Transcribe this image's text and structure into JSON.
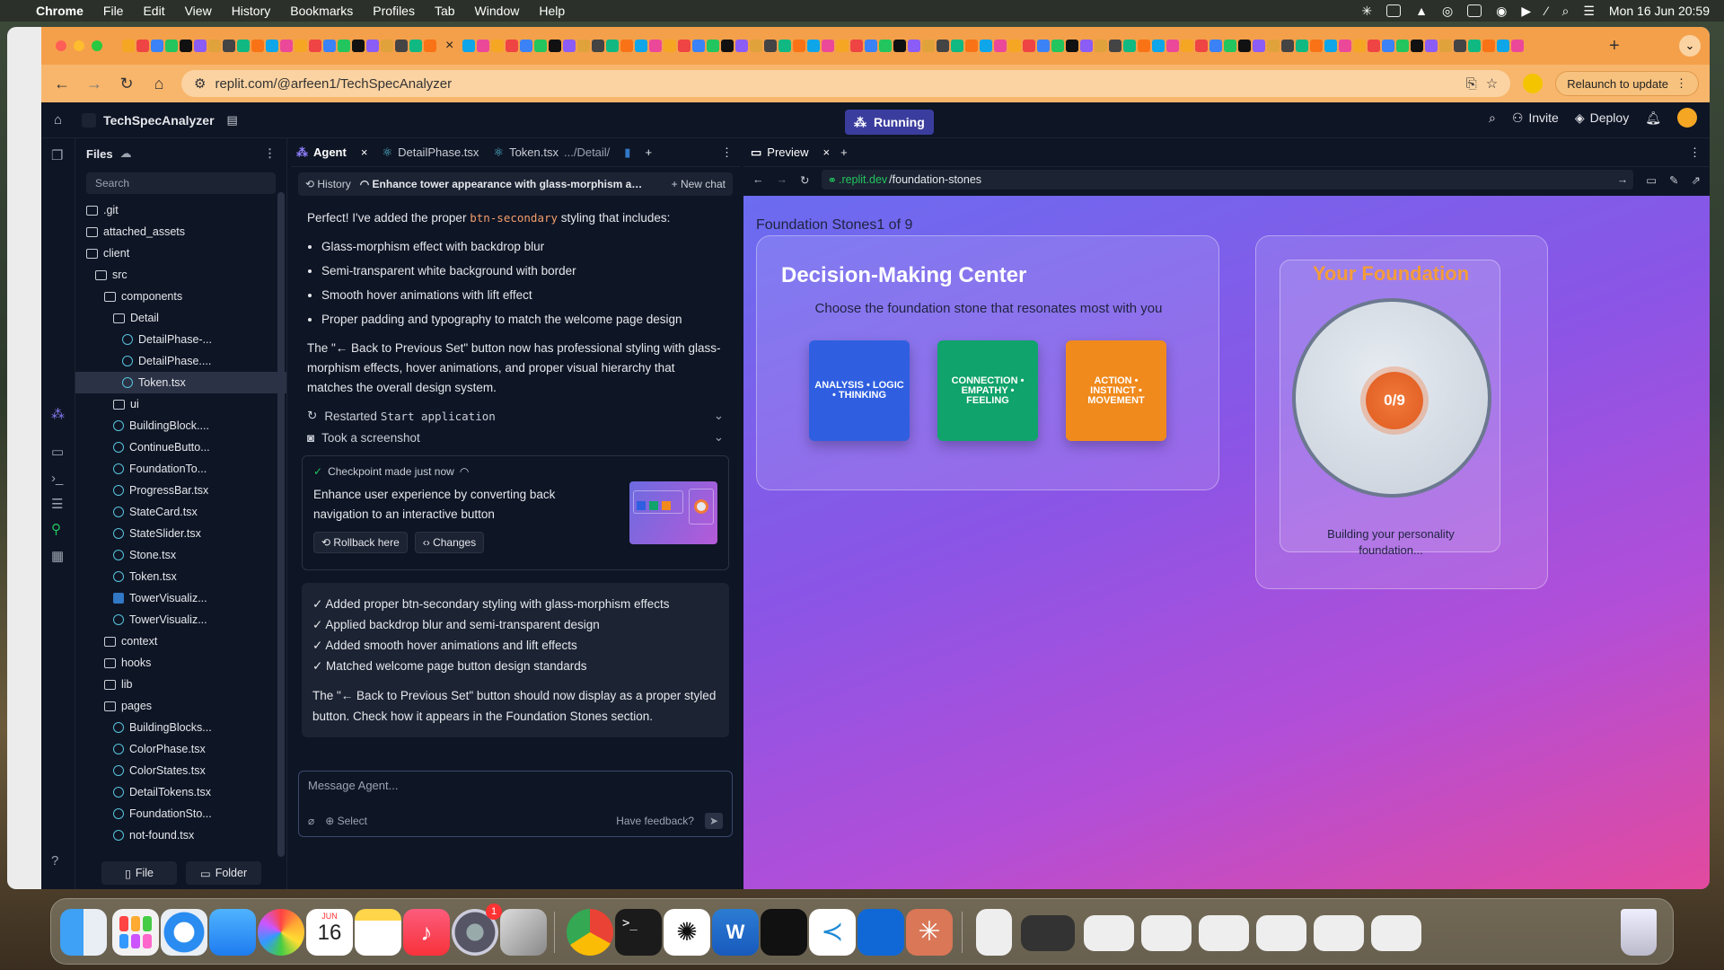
{
  "menubar": {
    "apple": "",
    "app": "Chrome",
    "items": [
      "File",
      "Edit",
      "View",
      "History",
      "Bookmarks",
      "Profiles",
      "Tab",
      "Window",
      "Help"
    ],
    "clock": "Mon 16 Jun  20:59"
  },
  "browser": {
    "url": "replit.com/@arfeen1/TechSpecAnalyzer",
    "relaunch": "Relaunch to update"
  },
  "replit": {
    "project": "TechSpecAnalyzer",
    "status": "Running",
    "invite": "Invite",
    "deploy": "Deploy"
  },
  "files": {
    "title": "Files",
    "search_placeholder": "Search",
    "new_file": "File",
    "new_folder": "Folder",
    "tree": [
      {
        "name": ".git",
        "type": "folder",
        "depth": 0
      },
      {
        "name": "attached_assets",
        "type": "folder",
        "depth": 0
      },
      {
        "name": "client",
        "type": "folder",
        "depth": 0
      },
      {
        "name": "src",
        "type": "folder",
        "depth": 1
      },
      {
        "name": "components",
        "type": "folder",
        "depth": 2
      },
      {
        "name": "Detail",
        "type": "folder",
        "depth": 3
      },
      {
        "name": "DetailPhase-...",
        "type": "react",
        "depth": 4
      },
      {
        "name": "DetailPhase....",
        "type": "react",
        "depth": 4
      },
      {
        "name": "Token.tsx",
        "type": "react",
        "depth": 4,
        "selected": true
      },
      {
        "name": "ui",
        "type": "folder",
        "depth": 3
      },
      {
        "name": "BuildingBlock....",
        "type": "react",
        "depth": 3
      },
      {
        "name": "ContinueButto...",
        "type": "react",
        "depth": 3
      },
      {
        "name": "FoundationTo...",
        "type": "react",
        "depth": 3
      },
      {
        "name": "ProgressBar.tsx",
        "type": "react",
        "depth": 3
      },
      {
        "name": "StateCard.tsx",
        "type": "react",
        "depth": 3
      },
      {
        "name": "StateSlider.tsx",
        "type": "react",
        "depth": 3
      },
      {
        "name": "Stone.tsx",
        "type": "react",
        "depth": 3
      },
      {
        "name": "Token.tsx",
        "type": "react",
        "depth": 3
      },
      {
        "name": "TowerVisualiz...",
        "type": "ts",
        "depth": 3
      },
      {
        "name": "TowerVisualiz...",
        "type": "react",
        "depth": 3
      },
      {
        "name": "context",
        "type": "folder",
        "depth": 2
      },
      {
        "name": "hooks",
        "type": "folder",
        "depth": 2
      },
      {
        "name": "lib",
        "type": "folder",
        "depth": 2
      },
      {
        "name": "pages",
        "type": "folder",
        "depth": 2
      },
      {
        "name": "BuildingBlocks...",
        "type": "react",
        "depth": 3
      },
      {
        "name": "ColorPhase.tsx",
        "type": "react",
        "depth": 3
      },
      {
        "name": "ColorStates.tsx",
        "type": "react",
        "depth": 3
      },
      {
        "name": "DetailTokens.tsx",
        "type": "react",
        "depth": 3
      },
      {
        "name": "FoundationSto...",
        "type": "react",
        "depth": 3
      },
      {
        "name": "not-found.tsx",
        "type": "react",
        "depth": 3
      }
    ]
  },
  "agent": {
    "tabs": [
      {
        "label": "Agent"
      },
      {
        "label": "DetailPhase.tsx"
      },
      {
        "label": "Token.tsx",
        "path": ".../Detail/"
      }
    ],
    "history": "History",
    "thread": "Enhance tower appearance with glass-morphism and...",
    "new_chat": "New chat",
    "intro_pre": "Perfect! I've added the proper ",
    "intro_code": "btn-secondary",
    "intro_post": " styling that includes:",
    "bullets": [
      "Glass-morphism effect with backdrop blur",
      "Semi-transparent white background with border",
      "Smooth hover animations with lift effect",
      "Proper padding and typography to match the welcome page design"
    ],
    "para": "The \"← Back to Previous Set\" button now has professional styling with glass-morphism effects, hover animations, and proper visual hierarchy that matches the overall design system.",
    "action1_pre": "Restarted ",
    "action1_code": "Start application",
    "action2": "Took a screenshot",
    "checkpoint": {
      "status": "Checkpoint made just now",
      "desc": "Enhance user experience by converting back navigation to an interactive button",
      "rollback": "Rollback here",
      "changes": "Changes"
    },
    "summary": [
      "✓ Added proper btn-secondary styling with glass-morphism effects",
      "✓ Applied backdrop blur and semi-transparent design",
      "✓ Added smooth hover animations and lift effects",
      "✓ Matched welcome page button design standards"
    ],
    "summary_para": "The \"← Back to Previous Set\" button should now display as a proper styled button. Check how it appears in the Foundation Stones section.",
    "input_placeholder": "Message Agent...",
    "select": "Select",
    "feedback": "Have feedback?"
  },
  "preview": {
    "tab": "Preview",
    "url_host": ".replit.dev",
    "url_path": "/foundation-stones",
    "counter": "Foundation Stones1 of 9",
    "card_title": "Decision-Making Center",
    "card_sub": "Choose the foundation stone that resonates most with you",
    "stones": [
      {
        "label": "ANALYSIS • LOGIC • THINKING",
        "color": "#2f5fe0"
      },
      {
        "label": "CONNECTION • EMPATHY • FEELING",
        "color": "#10a36b"
      },
      {
        "label": "ACTION • INSTINCT • MOVEMENT",
        "color": "#f08a1c"
      }
    ],
    "foundation_title": "Your Foundation",
    "progress": "0/9",
    "foundation_caption": "Building your personality foundation..."
  },
  "dock": {
    "calendar_month": "JUN",
    "calendar_day": "16",
    "badge": "1"
  }
}
